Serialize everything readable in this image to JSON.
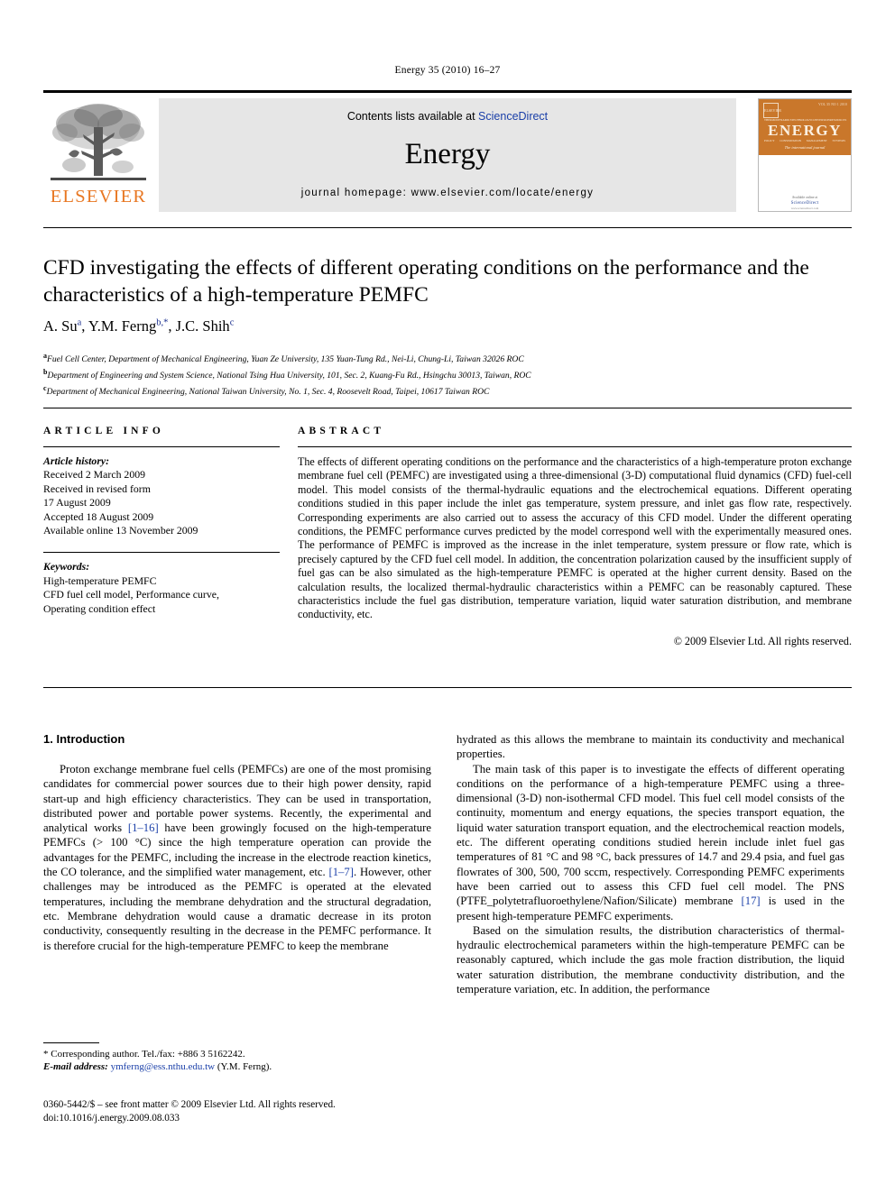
{
  "running_head": "Energy 35 (2010) 16–27",
  "masthead": {
    "publisher_name": "ELSEVIER",
    "contents_prefix": "Contents lists available at ",
    "contents_link": "ScienceDirect",
    "journal_name": "Energy",
    "journal_homepage": "journal homepage: www.elsevier.com/locate/energy",
    "cover": {
      "title": "ENERGY",
      "subtitle": "The international journal",
      "badge": "ELSEVIER",
      "issue": "VOL 35 NO 1 2010",
      "top_labels": [
        "THERMODYNAMICS",
        "TECHNOLOGY",
        "CONVERSION",
        "RESOURCES"
      ],
      "bottom_labels": [
        "POLICY",
        "CONSERVATION",
        "MANAGEMENT",
        "SYSTEMS"
      ],
      "available_text": "Available online at",
      "sciencedirect": "ScienceDirect",
      "url": "www.sciencedirect.com"
    }
  },
  "article": {
    "title": "CFD investigating the effects of different operating conditions on the performance and the characteristics of a high-temperature PEMFC",
    "authors": [
      {
        "name": "A. Su",
        "marks": "a",
        "sep": ", "
      },
      {
        "name": "Y.M. Ferng",
        "marks": "b,*",
        "sep": ", "
      },
      {
        "name": "J.C. Shih",
        "marks": "c",
        "sep": ""
      }
    ],
    "affiliations": [
      {
        "mark": "a",
        "text": "Fuel Cell Center, Department of Mechanical Engineering, Yuan Ze University, 135 Yuan-Tung Rd., Nei-Li, Chung-Li, Taiwan 32026 ROC"
      },
      {
        "mark": "b",
        "text": "Department of Engineering and System Science, National Tsing Hua University, 101, Sec. 2, Kuang-Fu Rd., Hsingchu 30013, Taiwan, ROC"
      },
      {
        "mark": "c",
        "text": "Department of Mechanical Engineering, National Taiwan University, No. 1, Sec. 4, Roosevelt Road, Taipei, 10617 Taiwan ROC"
      }
    ]
  },
  "article_info": {
    "label": "ARTICLE INFO",
    "history_label": "Article history:",
    "history": [
      "Received 2 March 2009",
      "Received in revised form",
      "17 August 2009",
      "Accepted 18 August 2009",
      "Available online 13 November 2009"
    ],
    "keywords_label": "Keywords:",
    "keywords": [
      "High-temperature PEMFC",
      "CFD fuel cell model, Performance curve,",
      "Operating condition effect"
    ]
  },
  "abstract": {
    "label": "ABSTRACT",
    "text": "The effects of different operating conditions on the performance and the characteristics of a high-temperature proton exchange membrane fuel cell (PEMFC) are investigated using a three-dimensional (3-D) computational fluid dynamics (CFD) fuel-cell model. This model consists of the thermal-hydraulic equations and the electrochemical equations. Different operating conditions studied in this paper include the inlet gas temperature, system pressure, and inlet gas flow rate, respectively. Corresponding experiments are also carried out to assess the accuracy of this CFD model. Under the different operating conditions, the PEMFC performance curves predicted by the model correspond well with the experimentally measured ones. The performance of PEMFC is improved as the increase in the inlet temperature, system pressure or flow rate, which is precisely captured by the CFD fuel cell model. In addition, the concentration polarization caused by the insufficient supply of fuel gas can be also simulated as the high-temperature PEMFC is operated at the higher current density. Based on the calculation results, the localized thermal-hydraulic characteristics within a PEMFC can be reasonably captured. These characteristics include the fuel gas distribution, temperature variation, liquid water saturation distribution, and membrane conductivity, etc.",
    "copyright": "© 2009 Elsevier Ltd. All rights reserved."
  },
  "body": {
    "section_heading": "1. Introduction",
    "left_paragraphs": [
      {
        "segments": [
          {
            "type": "text",
            "value": "Proton exchange membrane fuel cells (PEMFCs) are one of the most promising candidates for commercial power sources due to their high power density, rapid start-up and high efficiency characteristics. They can be used in transportation, distributed power and portable power systems. Recently, the experimental and analytical works "
          },
          {
            "type": "cite",
            "value": "[1–16]"
          },
          {
            "type": "text",
            "value": " have been growingly focused on the high-temperature PEMFCs (> 100 °C) since the high temperature operation can provide the advantages for the PEMFC, including the increase in the electrode reaction kinetics, the CO tolerance, and the simplified water management, etc. "
          },
          {
            "type": "cite",
            "value": "[1–7]"
          },
          {
            "type": "text",
            "value": ". However, other challenges may be introduced as the PEMFC is operated at the elevated temperatures, including the membrane dehydration and the structural degradation, etc. Membrane dehydration would cause a dramatic decrease in its proton conductivity, consequently resulting in the decrease in the PEMFC performance. It is therefore crucial for the high-temperature PEMFC to keep the membrane"
          }
        ]
      }
    ],
    "right_paragraphs": [
      {
        "indent": false,
        "segments": [
          {
            "type": "text",
            "value": "hydrated as this allows the membrane to maintain its conductivity and mechanical properties."
          }
        ]
      },
      {
        "indent": true,
        "segments": [
          {
            "type": "text",
            "value": "The main task of this paper is to investigate the effects of different operating conditions on the performance of a high-temperature PEMFC using a three-dimensional (3-D) non-isothermal CFD model. This fuel cell model consists of the continuity, momentum and energy equations, the species transport equation, the liquid water saturation transport equation, and the electrochemical reaction models, etc. The different operating conditions studied herein include inlet fuel gas temperatures of 81 °C and 98 °C, back pressures of 14.7 and 29.4 psia, and fuel gas flowrates of 300, 500, 700 sccm, respectively. Corresponding PEMFC experiments have been carried out to assess this CFD fuel cell model. The PNS (PTFE_polytetrafluoroethylene/Nafion/Silicate) membrane "
          },
          {
            "type": "cite",
            "value": "[17]"
          },
          {
            "type": "text",
            "value": " is used in the present high-temperature PEMFC experiments."
          }
        ]
      },
      {
        "indent": true,
        "segments": [
          {
            "type": "text",
            "value": "Based on the simulation results, the distribution characteristics of thermal-hydraulic electrochemical parameters within the high-temperature PEMFC can be reasonably captured, which include the gas mole fraction distribution, the liquid water saturation distribution, the membrane conductivity distribution, and the temperature variation, etc. In addition, the performance"
          }
        ]
      }
    ]
  },
  "footnotes": {
    "corresponding": "* Corresponding author. Tel./fax: +886 3 5162242.",
    "email_label": "E-mail address:",
    "email": "ymferng@ess.nthu.edu.tw",
    "email_suffix": " (Y.M. Ferng).",
    "issn_line": "0360-5442/$ – see front matter © 2009 Elsevier Ltd. All rights reserved.",
    "doi_line": "doi:10.1016/j.energy.2009.08.033"
  },
  "colors": {
    "elsevier_orange": "#E87722",
    "link_blue": "#1a3fa8",
    "masthead_gray": "#e6e6e6",
    "cover_orange": "#c9772b"
  }
}
